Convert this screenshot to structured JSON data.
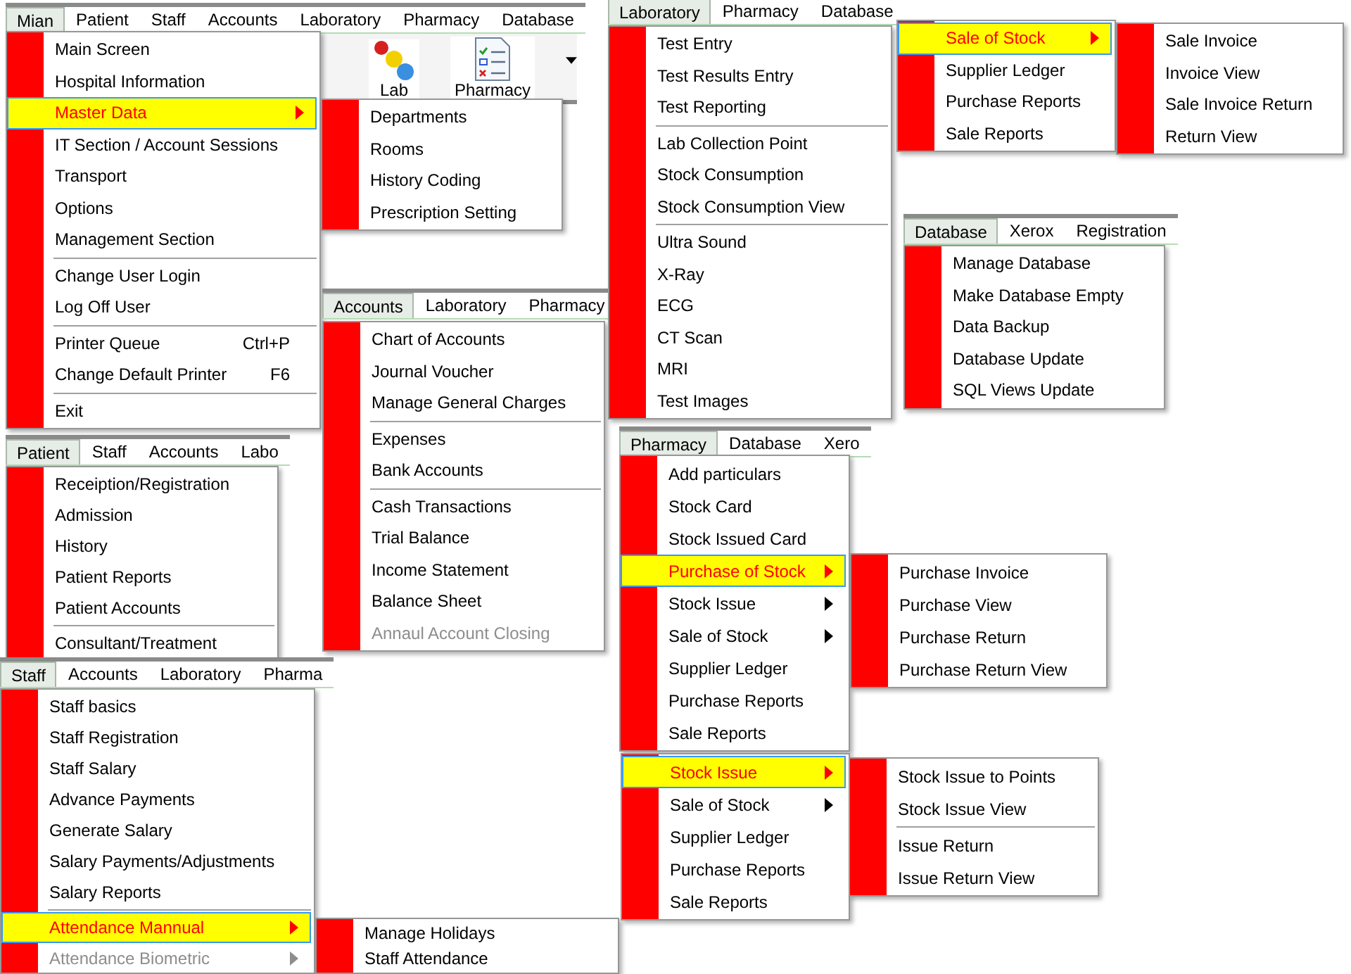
{
  "fragments": [
    {
      "menubar": [
        {
          "label": "Mian",
          "selected": true
        },
        {
          "label": "Patient",
          "selected": false
        },
        {
          "label": "Staff",
          "selected": false
        },
        {
          "label": "Accounts",
          "selected": false
        },
        {
          "label": "Laboratory",
          "selected": false
        },
        {
          "label": "Pharmacy",
          "selected": false
        },
        {
          "label": "Database",
          "selected": false
        }
      ],
      "toolbar": [
        {
          "kind": "lab",
          "label": "Lab"
        },
        {
          "kind": "pharmacy",
          "label": "Pharmacy"
        }
      ],
      "menu": [
        {
          "kind": "item",
          "label": "Main Screen",
          "highlighted": false,
          "disabled": false,
          "submenu": false
        },
        {
          "kind": "item",
          "label": "Hospital Information",
          "highlighted": false,
          "disabled": false,
          "submenu": false
        },
        {
          "kind": "item",
          "label": "Master Data",
          "highlighted": true,
          "disabled": false,
          "submenu": true
        },
        {
          "kind": "item",
          "label": "IT Section / Account Sessions",
          "highlighted": false,
          "disabled": false,
          "submenu": false
        },
        {
          "kind": "item",
          "label": "Transport",
          "highlighted": false,
          "disabled": false,
          "submenu": false
        },
        {
          "kind": "item",
          "label": "Options",
          "highlighted": false,
          "disabled": false,
          "submenu": false
        },
        {
          "kind": "item",
          "label": "Management Section",
          "highlighted": false,
          "disabled": false,
          "submenu": false
        },
        {
          "kind": "separator"
        },
        {
          "kind": "item",
          "label": "Change User Login",
          "highlighted": false,
          "disabled": false,
          "submenu": false
        },
        {
          "kind": "item",
          "label": "Log Off User",
          "highlighted": false,
          "disabled": false,
          "submenu": false
        },
        {
          "kind": "separator"
        },
        {
          "kind": "item",
          "label": "Printer Queue",
          "shortcut": "Ctrl+P",
          "highlighted": false,
          "disabled": false,
          "submenu": false
        },
        {
          "kind": "item",
          "label": "Change Default Printer",
          "shortcut": "F6",
          "highlighted": false,
          "disabled": false,
          "submenu": false
        },
        {
          "kind": "separator"
        },
        {
          "kind": "item",
          "label": "Exit",
          "highlighted": false,
          "disabled": false,
          "submenu": false
        }
      ],
      "submenu": [
        {
          "kind": "item",
          "label": "Departments",
          "highlighted": false,
          "disabled": false,
          "submenu": false
        },
        {
          "kind": "item",
          "label": "Rooms",
          "highlighted": false,
          "disabled": false,
          "submenu": false
        },
        {
          "kind": "item",
          "label": "History Coding",
          "highlighted": false,
          "disabled": false,
          "submenu": false
        },
        {
          "kind": "item",
          "label": "Prescription Setting",
          "highlighted": false,
          "disabled": false,
          "submenu": false
        }
      ]
    },
    {
      "menubar": [
        {
          "label": "Patient",
          "selected": true
        },
        {
          "label": "Staff",
          "selected": false
        },
        {
          "label": "Accounts",
          "selected": false
        },
        {
          "label": "Labo",
          "selected": false
        }
      ],
      "menu": [
        {
          "kind": "item",
          "label": "Receiption/Registration",
          "highlighted": false,
          "disabled": false,
          "submenu": false
        },
        {
          "kind": "item",
          "label": "Admission",
          "highlighted": false,
          "disabled": false,
          "submenu": false
        },
        {
          "kind": "item",
          "label": "History",
          "highlighted": false,
          "disabled": false,
          "submenu": false
        },
        {
          "kind": "item",
          "label": "Patient Reports",
          "highlighted": false,
          "disabled": false,
          "submenu": false
        },
        {
          "kind": "item",
          "label": "Patient Accounts",
          "highlighted": false,
          "disabled": false,
          "submenu": false
        },
        {
          "kind": "separator"
        },
        {
          "kind": "item",
          "label": "Consultant/Treatment",
          "highlighted": false,
          "disabled": false,
          "submenu": false
        }
      ]
    },
    {
      "menubar": [
        {
          "label": "Staff",
          "selected": true
        },
        {
          "label": "Accounts",
          "selected": false
        },
        {
          "label": "Laboratory",
          "selected": false
        },
        {
          "label": "Pharma",
          "selected": false
        }
      ],
      "menu": [
        {
          "kind": "item",
          "label": "Staff basics",
          "highlighted": false,
          "disabled": false,
          "submenu": false
        },
        {
          "kind": "item",
          "label": "Staff Registration",
          "highlighted": false,
          "disabled": false,
          "submenu": false
        },
        {
          "kind": "item",
          "label": "Staff Salary",
          "highlighted": false,
          "disabled": false,
          "submenu": false
        },
        {
          "kind": "item",
          "label": "Advance Payments",
          "highlighted": false,
          "disabled": false,
          "submenu": false
        },
        {
          "kind": "item",
          "label": "Generate Salary",
          "highlighted": false,
          "disabled": false,
          "submenu": false
        },
        {
          "kind": "item",
          "label": "Salary Payments/Adjustments",
          "highlighted": false,
          "disabled": false,
          "submenu": false
        },
        {
          "kind": "item",
          "label": "Salary Reports",
          "highlighted": false,
          "disabled": false,
          "submenu": false
        },
        {
          "kind": "separator"
        },
        {
          "kind": "item",
          "label": "Attendance Mannual",
          "highlighted": true,
          "disabled": false,
          "submenu": true
        },
        {
          "kind": "item",
          "label": "Attendance Biometric",
          "highlighted": false,
          "disabled": true,
          "submenu": true
        }
      ],
      "submenu": [
        {
          "kind": "item",
          "label": "Manage Holidays",
          "highlighted": false,
          "disabled": false,
          "submenu": false
        },
        {
          "kind": "item",
          "label": "Staff Attendance",
          "highlighted": false,
          "disabled": false,
          "submenu": false
        }
      ]
    },
    {
      "menubar": [
        {
          "label": "Accounts",
          "selected": true
        },
        {
          "label": "Laboratory",
          "selected": false
        },
        {
          "label": "Pharmacy",
          "selected": false
        }
      ],
      "menu": [
        {
          "kind": "item",
          "label": "Chart of Accounts",
          "highlighted": false,
          "disabled": false,
          "submenu": false
        },
        {
          "kind": "item",
          "label": "Journal Voucher",
          "highlighted": false,
          "disabled": false,
          "submenu": false
        },
        {
          "kind": "item",
          "label": "Manage General Charges",
          "highlighted": false,
          "disabled": false,
          "submenu": false
        },
        {
          "kind": "separator"
        },
        {
          "kind": "item",
          "label": "Expenses",
          "highlighted": false,
          "disabled": false,
          "submenu": false
        },
        {
          "kind": "item",
          "label": "Bank Accounts",
          "highlighted": false,
          "disabled": false,
          "submenu": false
        },
        {
          "kind": "separator"
        },
        {
          "kind": "item",
          "label": "Cash Transactions",
          "highlighted": false,
          "disabled": false,
          "submenu": false
        },
        {
          "kind": "item",
          "label": "Trial Balance",
          "highlighted": false,
          "disabled": false,
          "submenu": false
        },
        {
          "kind": "item",
          "label": "Income Statement",
          "highlighted": false,
          "disabled": false,
          "submenu": false
        },
        {
          "kind": "item",
          "label": "Balance Sheet",
          "highlighted": false,
          "disabled": false,
          "submenu": false
        },
        {
          "kind": "item",
          "label": "Annaul Account Closing",
          "highlighted": false,
          "disabled": true,
          "submenu": false
        }
      ]
    },
    {
      "menubar": [
        {
          "label": "Laboratory",
          "selected": true
        },
        {
          "label": "Pharmacy",
          "selected": false
        },
        {
          "label": "Database",
          "selected": false
        }
      ],
      "menu": [
        {
          "kind": "item",
          "label": "Test Entry",
          "highlighted": false,
          "disabled": false,
          "submenu": false
        },
        {
          "kind": "item",
          "label": "Test Results Entry",
          "highlighted": false,
          "disabled": false,
          "submenu": false
        },
        {
          "kind": "item",
          "label": "Test Reporting",
          "highlighted": false,
          "disabled": false,
          "submenu": false
        },
        {
          "kind": "separator"
        },
        {
          "kind": "item",
          "label": "Lab Collection Point",
          "highlighted": false,
          "disabled": false,
          "submenu": false
        },
        {
          "kind": "item",
          "label": "Stock Consumption",
          "highlighted": false,
          "disabled": false,
          "submenu": false
        },
        {
          "kind": "item",
          "label": "Stock Consumption View",
          "highlighted": false,
          "disabled": false,
          "submenu": false
        },
        {
          "kind": "separator"
        },
        {
          "kind": "item",
          "label": "Ultra Sound",
          "highlighted": false,
          "disabled": false,
          "submenu": false
        },
        {
          "kind": "item",
          "label": "X-Ray",
          "highlighted": false,
          "disabled": false,
          "submenu": false
        },
        {
          "kind": "item",
          "label": "ECG",
          "highlighted": false,
          "disabled": false,
          "submenu": false
        },
        {
          "kind": "item",
          "label": "CT Scan",
          "highlighted": false,
          "disabled": false,
          "submenu": false
        },
        {
          "kind": "item",
          "label": "MRI",
          "highlighted": false,
          "disabled": false,
          "submenu": false
        },
        {
          "kind": "item",
          "label": "Test Images",
          "highlighted": false,
          "disabled": false,
          "submenu": false
        }
      ]
    },
    {
      "menubar": [
        {
          "label": "Pharmacy",
          "selected": true
        },
        {
          "label": "Database",
          "selected": false
        },
        {
          "label": "Xero",
          "selected": false
        }
      ],
      "menu": [
        {
          "kind": "item",
          "label": "Add particulars",
          "highlighted": false,
          "disabled": false,
          "submenu": false
        },
        {
          "kind": "item",
          "label": "Stock Card",
          "highlighted": false,
          "disabled": false,
          "submenu": false
        },
        {
          "kind": "item",
          "label": "Stock Issued Card",
          "highlighted": false,
          "disabled": false,
          "submenu": false
        },
        {
          "kind": "item",
          "label": "Purchase of Stock",
          "highlighted": true,
          "disabled": false,
          "submenu": true
        },
        {
          "kind": "item",
          "label": "Stock Issue",
          "highlighted": false,
          "disabled": false,
          "submenu": true
        },
        {
          "kind": "item",
          "label": "Sale of Stock",
          "highlighted": false,
          "disabled": false,
          "submenu": true
        },
        {
          "kind": "item",
          "label": "Supplier Ledger",
          "highlighted": false,
          "disabled": false,
          "submenu": false
        },
        {
          "kind": "item",
          "label": "Purchase Reports",
          "highlighted": false,
          "disabled": false,
          "submenu": false
        },
        {
          "kind": "item",
          "label": "Sale Reports",
          "highlighted": false,
          "disabled": false,
          "submenu": false
        }
      ],
      "submenu": [
        {
          "kind": "item",
          "label": "Purchase Invoice",
          "highlighted": false,
          "disabled": false,
          "submenu": false
        },
        {
          "kind": "item",
          "label": "Purchase View",
          "highlighted": false,
          "disabled": false,
          "submenu": false
        },
        {
          "kind": "item",
          "label": "Purchase Return",
          "highlighted": false,
          "disabled": false,
          "submenu": false
        },
        {
          "kind": "item",
          "label": "Purchase Return View",
          "highlighted": false,
          "disabled": false,
          "submenu": false
        }
      ]
    },
    {
      "menu": [
        {
          "kind": "item",
          "label": "Stock Issue",
          "highlighted": true,
          "disabled": false,
          "submenu": true
        },
        {
          "kind": "item",
          "label": "Sale of Stock",
          "highlighted": false,
          "disabled": false,
          "submenu": true
        },
        {
          "kind": "item",
          "label": "Supplier Ledger",
          "highlighted": false,
          "disabled": false,
          "submenu": false
        },
        {
          "kind": "item",
          "label": "Purchase Reports",
          "highlighted": false,
          "disabled": false,
          "submenu": false
        },
        {
          "kind": "item",
          "label": "Sale Reports",
          "highlighted": false,
          "disabled": false,
          "submenu": false
        }
      ],
      "submenu": [
        {
          "kind": "item",
          "label": "Stock Issue to Points",
          "highlighted": false,
          "disabled": false,
          "submenu": false
        },
        {
          "kind": "item",
          "label": "Stock Issue View",
          "highlighted": false,
          "disabled": false,
          "submenu": false
        },
        {
          "kind": "separator"
        },
        {
          "kind": "item",
          "label": "Issue Return",
          "highlighted": false,
          "disabled": false,
          "submenu": false
        },
        {
          "kind": "item",
          "label": "Issue Return View",
          "highlighted": false,
          "disabled": false,
          "submenu": false
        }
      ]
    },
    {
      "menu": [
        {
          "kind": "item",
          "label": "Sale of Stock",
          "highlighted": true,
          "disabled": false,
          "submenu": true
        },
        {
          "kind": "item",
          "label": "Supplier Ledger",
          "highlighted": false,
          "disabled": false,
          "submenu": false
        },
        {
          "kind": "item",
          "label": "Purchase Reports",
          "highlighted": false,
          "disabled": false,
          "submenu": false
        },
        {
          "kind": "item",
          "label": "Sale Reports",
          "highlighted": false,
          "disabled": false,
          "submenu": false
        }
      ],
      "submenu": [
        {
          "kind": "item",
          "label": "Sale Invoice",
          "highlighted": false,
          "disabled": false,
          "submenu": false
        },
        {
          "kind": "item",
          "label": "Invoice View",
          "highlighted": false,
          "disabled": false,
          "submenu": false
        },
        {
          "kind": "item",
          "label": "Sale Invoice Return",
          "highlighted": false,
          "disabled": false,
          "submenu": false
        },
        {
          "kind": "item",
          "label": "Return View",
          "highlighted": false,
          "disabled": false,
          "submenu": false
        }
      ]
    },
    {
      "menubar": [
        {
          "label": "Database",
          "selected": true
        },
        {
          "label": "Xerox",
          "selected": false
        },
        {
          "label": "Registration",
          "selected": false
        }
      ],
      "menu": [
        {
          "kind": "item",
          "label": "Manage Database",
          "highlighted": false,
          "disabled": false,
          "submenu": false
        },
        {
          "kind": "item",
          "label": "Make Database Empty",
          "highlighted": false,
          "disabled": false,
          "submenu": false
        },
        {
          "kind": "item",
          "label": "Data Backup",
          "highlighted": false,
          "disabled": false,
          "submenu": false
        },
        {
          "kind": "item",
          "label": "Database Update",
          "highlighted": false,
          "disabled": false,
          "submenu": false
        },
        {
          "kind": "item",
          "label": "SQL Views Update",
          "highlighted": false,
          "disabled": false,
          "submenu": false
        }
      ]
    }
  ]
}
